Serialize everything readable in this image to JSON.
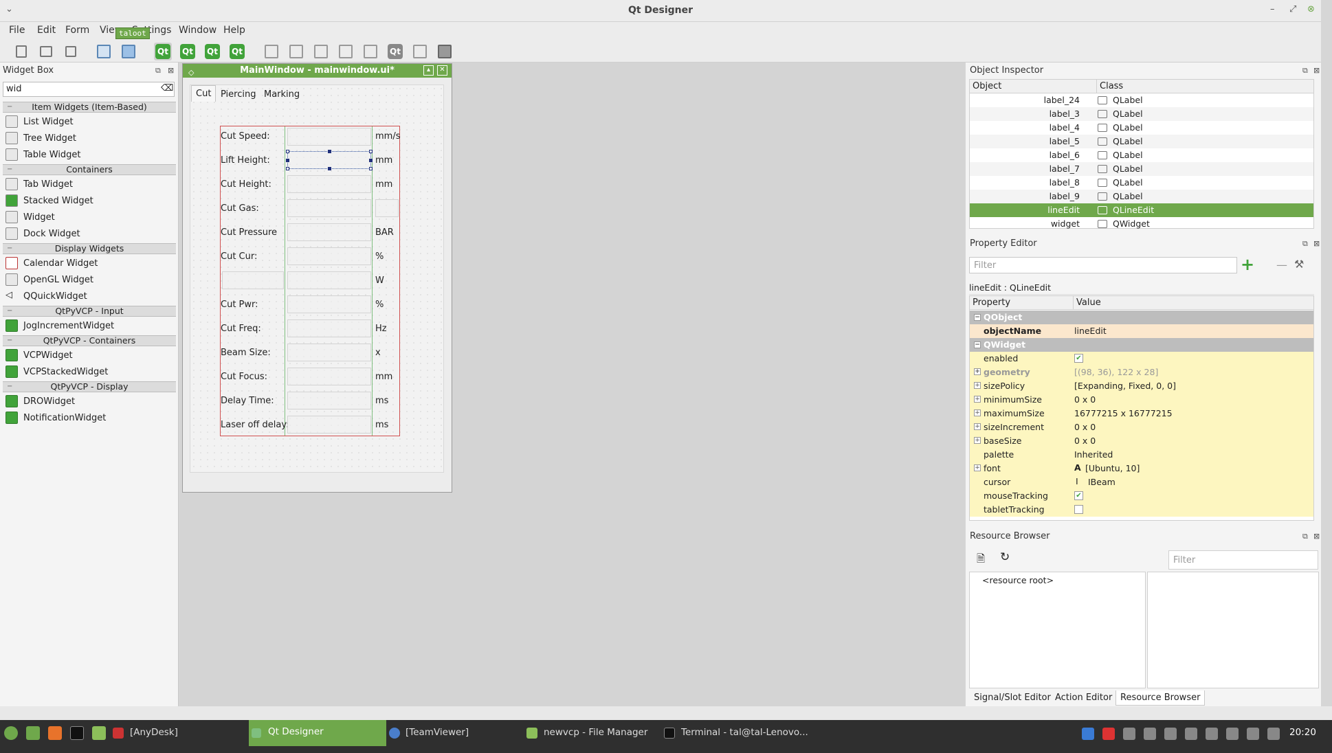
{
  "window": {
    "title": "Qt Designer"
  },
  "menubar": [
    "File",
    "Edit",
    "Form",
    "View",
    "Settings",
    "Window",
    "Help"
  ],
  "tooltip": "taloot",
  "widget_box": {
    "title": "Widget Box",
    "filter": "wid",
    "categories": [
      {
        "name": "Item Widgets (Item-Based)",
        "items": [
          "List Widget",
          "Tree Widget",
          "Table Widget"
        ]
      },
      {
        "name": "Containers",
        "items": [
          "Tab Widget",
          "Stacked Widget",
          "Widget",
          "Dock Widget"
        ]
      },
      {
        "name": "Display Widgets",
        "items": [
          "Calendar Widget",
          "OpenGL Widget",
          "QQuickWidget"
        ]
      },
      {
        "name": "QtPyVCP - Input",
        "items": [
          "JogIncrementWidget"
        ]
      },
      {
        "name": "QtPyVCP - Containers",
        "items": [
          "VCPWidget",
          "VCPStackedWidget"
        ]
      },
      {
        "name": "QtPyVCP - Display",
        "items": [
          "DROWidget",
          "NotificationWidget"
        ]
      }
    ]
  },
  "form": {
    "title": "MainWindow - mainwindow.ui*",
    "tabs": [
      "Cut",
      "Piercing",
      "Marking"
    ],
    "rows": [
      {
        "label": "Cut Speed:",
        "unit": "mm/s"
      },
      {
        "label": "Lift Height:",
        "unit": "mm"
      },
      {
        "label": "Cut Height:",
        "unit": "mm"
      },
      {
        "label": "Cut Gas:",
        "unit": ""
      },
      {
        "label": "Cut Pressure",
        "unit": "BAR"
      },
      {
        "label": "Cut Cur:",
        "unit": "%"
      },
      {
        "label": "",
        "unit": "W"
      },
      {
        "label": "Cut Pwr:",
        "unit": "%"
      },
      {
        "label": "Cut Freq:",
        "unit": "Hz"
      },
      {
        "label": "Beam Size:",
        "unit": "x"
      },
      {
        "label": "Cut Focus:",
        "unit": "mm"
      },
      {
        "label": "Delay Time:",
        "unit": "ms"
      },
      {
        "label": "Laser off delay:",
        "unit": "ms"
      }
    ]
  },
  "object_inspector": {
    "title": "Object Inspector",
    "columns": [
      "Object",
      "Class"
    ],
    "rows": [
      {
        "object": "label_24",
        "class": "QLabel"
      },
      {
        "object": "label_3",
        "class": "QLabel"
      },
      {
        "object": "label_4",
        "class": "QLabel"
      },
      {
        "object": "label_5",
        "class": "QLabel"
      },
      {
        "object": "label_6",
        "class": "QLabel"
      },
      {
        "object": "label_7",
        "class": "QLabel"
      },
      {
        "object": "label_8",
        "class": "QLabel"
      },
      {
        "object": "label_9",
        "class": "QLabel"
      },
      {
        "object": "lineEdit",
        "class": "QLineEdit"
      },
      {
        "object": "widget",
        "class": "QWidget"
      }
    ],
    "selected_index": 8
  },
  "property_editor": {
    "title": "Property Editor",
    "filter_placeholder": "Filter",
    "object": "lineEdit : QLineEdit",
    "columns": [
      "Property",
      "Value"
    ],
    "rows": [
      {
        "kind": "group",
        "name": "QObject"
      },
      {
        "kind": "o",
        "name": "objectName",
        "value": "lineEdit",
        "bold": true
      },
      {
        "kind": "group",
        "name": "QWidget"
      },
      {
        "kind": "y",
        "name": "enabled",
        "check": true
      },
      {
        "kind": "y",
        "name": "geometry",
        "value": "[(98, 36), 122 x 28]",
        "expand": true,
        "dim": true
      },
      {
        "kind": "y",
        "name": "sizePolicy",
        "value": "[Expanding, Fixed, 0, 0]",
        "expand": true
      },
      {
        "kind": "y",
        "name": "minimumSize",
        "value": "0 x 0",
        "expand": true
      },
      {
        "kind": "y",
        "name": "maximumSize",
        "value": "16777215 x 16777215",
        "expand": true
      },
      {
        "kind": "y",
        "name": "sizeIncrement",
        "value": "0 x 0",
        "expand": true
      },
      {
        "kind": "y",
        "name": "baseSize",
        "value": "0 x 0",
        "expand": true
      },
      {
        "kind": "y",
        "name": "palette",
        "value": "Inherited"
      },
      {
        "kind": "y",
        "name": "font",
        "value": "[Ubuntu, 10]",
        "expand": true
      },
      {
        "kind": "y",
        "name": "cursor",
        "value": "IBeam"
      },
      {
        "kind": "y",
        "name": "mouseTracking",
        "check": true
      },
      {
        "kind": "y",
        "name": "tabletTracking",
        "check": false
      }
    ]
  },
  "resource_browser": {
    "title": "Resource Browser",
    "filter_placeholder": "Filter",
    "root": "<resource root>"
  },
  "bottom_tabs": [
    "Signal/Slot Editor",
    "Action Editor",
    "Resource Browser"
  ],
  "taskbar": {
    "items": [
      "[AnyDesk]",
      "Qt Designer",
      "[TeamViewer]",
      "newvcp - File Manager",
      "Terminal - tal@tal-Lenovo..."
    ],
    "clock": "20:20"
  }
}
